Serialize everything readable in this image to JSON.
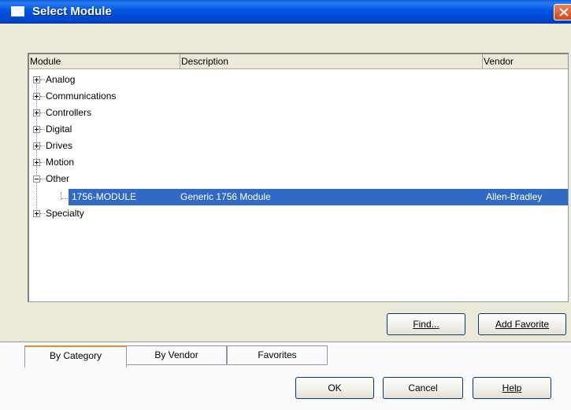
{
  "window": {
    "title": "Select Module"
  },
  "list": {
    "columns": [
      "Module",
      "Description",
      "Vendor"
    ],
    "categories": [
      {
        "label": "Analog",
        "expanded": false
      },
      {
        "label": "Communications",
        "expanded": false
      },
      {
        "label": "Controllers",
        "expanded": false
      },
      {
        "label": "Digital",
        "expanded": false
      },
      {
        "label": "Drives",
        "expanded": false
      },
      {
        "label": "Motion",
        "expanded": false
      },
      {
        "label": "Other",
        "expanded": true
      },
      {
        "label": "Specialty",
        "expanded": false
      }
    ],
    "selected_item": {
      "module": "1756-MODULE",
      "description": "Generic 1756 Module",
      "vendor": "Allen-Bradley"
    }
  },
  "buttons": {
    "find": "Find...",
    "add_favorite": "Add Favorite",
    "ok": "OK",
    "cancel": "Cancel",
    "help": "Help"
  },
  "tabs": [
    "By Category",
    "By Vendor",
    "Favorites"
  ],
  "colors": {
    "title_bar": "#0054e3",
    "selection": "#316ac5",
    "dialog_bg": "#ece9d8"
  }
}
